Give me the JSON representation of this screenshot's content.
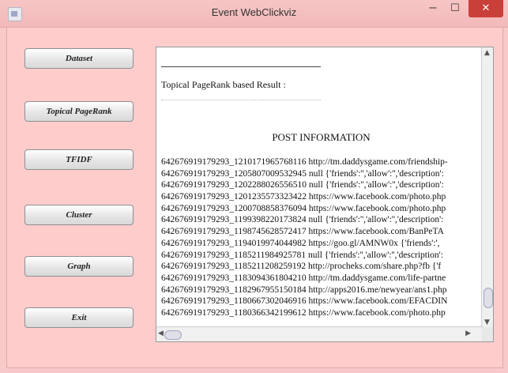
{
  "window": {
    "title": "Event WebClickviz",
    "minimize_glyph": "–",
    "maximize_glyph": "☐",
    "close_glyph": "✕"
  },
  "sidebar": {
    "buttons": [
      "Dataset",
      "Topical PageRank",
      "TFIDF",
      "Cluster",
      "Graph",
      "Exit"
    ]
  },
  "output": {
    "separator": "------------------------------------------------------------",
    "heading": "Topical PageRank based Result :",
    "post_title": "POST   INFORMATION",
    "rows": [
      "642676919179293_1210171965768116  http://tm.daddysgame.com/friendship-",
      "642676919179293_1205807009532945  null  {'friends':'','allow':'','description':",
      "642676919179293_1202288026556510  null  {'friends':'','allow':'','description':",
      "642676919179293_1201235573323422  https://www.facebook.com/photo.php",
      "642676919179293_1200708858376094  https://www.facebook.com/photo.php",
      "642676919179293_1199398220173824  null  {'friends':'','allow':'','description':",
      "642676919179293_1198745628572417  https://www.facebook.com/BanPeTA",
      "642676919179293_1194019974044982  https://goo.gl/AMNW0x  {'friends':',",
      "642676919179293_1185211984925781  null  {'friends':'','allow':'','description':",
      "642676919179293_1185211208259192  http://procheks.com/share.php?fb  {'f",
      "642676919179293_1183094361804210  http://tm.daddysgame.com/life-partne",
      "642676919179293_1182967955150184  http://apps2016.me/newyear/ans1.php",
      "642676919179293_1180667302046916  https://www.facebook.com/EFACDIN",
      "642676919179293_1180366342199612  https://www.facebook.com/photo.php"
    ]
  }
}
